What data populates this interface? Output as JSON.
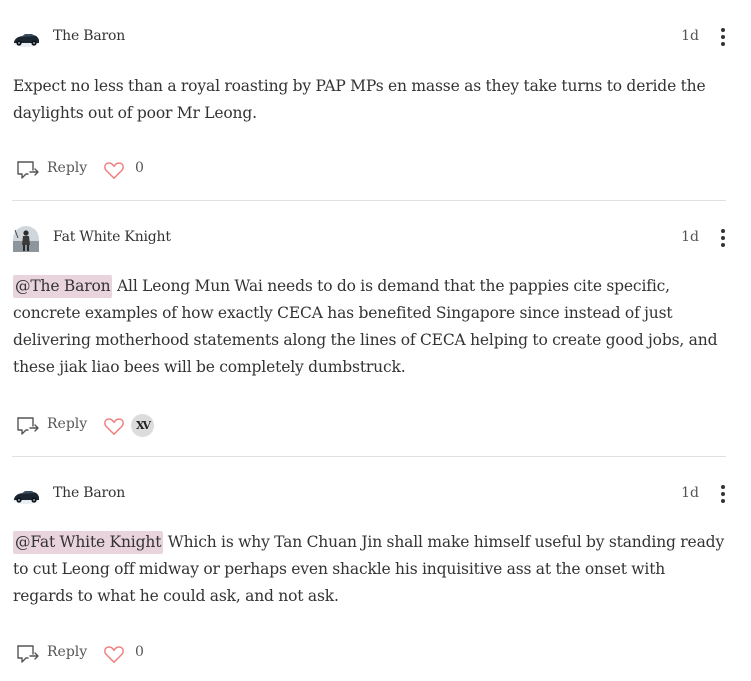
{
  "comments": [
    {
      "author": "The Baron",
      "time": "1d",
      "mention": "",
      "text": "Expect no less than a royal roasting by PAP MPs en masse as they take turns to deride the daylights out of poor Mr Leong.",
      "reply_label": "Reply",
      "like_count": "0",
      "avatar_icon": "car-avatar"
    },
    {
      "author": "Fat White Knight",
      "time": "1d",
      "mention": "@The Baron",
      "text": "All Leong Mun Wai needs to do is demand that the pappies cite specific, concrete examples of how exactly CECA has benefited Singapore since instead of just delivering motherhood statements along the lines of CECA helping to create good jobs, and these jiak liao bees will be completely dumbstruck.",
      "reply_label": "Reply",
      "liker_initials": "XV",
      "avatar_icon": "person-avatar"
    },
    {
      "author": "The Baron",
      "time": "1d",
      "mention": "@Fat White Knight",
      "text": "Which is why Tan Chuan Jin shall make himself useful by standing ready to cut Leong off midway or perhaps even shackle his inquisitive ass at the onset with regards to what he could ask, and not ask.",
      "reply_label": "Reply",
      "like_count": "0",
      "avatar_icon": "car-avatar"
    }
  ],
  "colors": {
    "heart": "#f08080",
    "mention_bg": "#e9d4dd",
    "divider": "#e0e0e0",
    "text": "#333333"
  }
}
